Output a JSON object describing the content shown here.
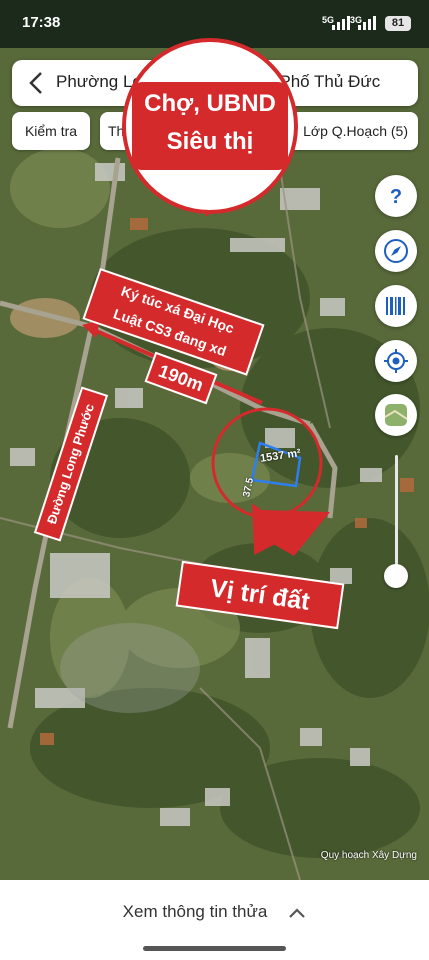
{
  "status_bar": {
    "time": "17:38",
    "signal_1": "5G",
    "signal_2": "3G",
    "battery": "81"
  },
  "search": {
    "title": "Phường Long Phước, Thành Phố Thủ Đức"
  },
  "chips": {
    "check": "Kiểm tra",
    "partial": "Th",
    "layers": "Lớp Q.Hoạch (5)"
  },
  "callout": {
    "line1": "Chợ, UBND",
    "line2": "Siêu thị"
  },
  "annotations": {
    "dormitory": "Ký túc xá Đại Học Luật CS3 đang xd",
    "dormitory_line1": "Ký túc xá Đại Học",
    "dormitory_line2": "Luật CS3 đang xd",
    "distance": "190m",
    "road": "Đường Long Phước",
    "location": "Vị trí đất"
  },
  "parcel": {
    "area": "1537 m²",
    "dimension": "37.5"
  },
  "attribution": "Quy hoạch Xây Dựng",
  "bottom": {
    "label": "Xem thông tin thửa"
  },
  "right_buttons": [
    "help-icon",
    "compass-icon",
    "barcode-icon",
    "locate-icon",
    "map-layer-icon"
  ],
  "colors": {
    "accent_red": "#d42a2c",
    "button_blue": "#1d5fbf",
    "parcel_blue": "#2d7ff0"
  }
}
